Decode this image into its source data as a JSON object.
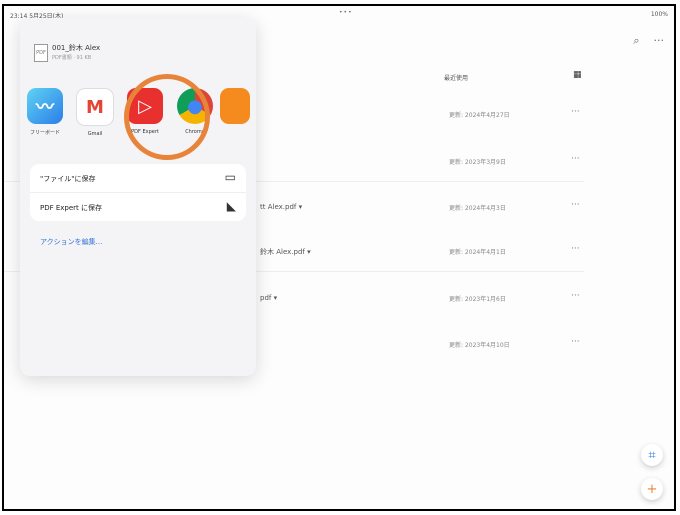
{
  "status": {
    "left": "23:14 5月25日(木)",
    "center": "•••",
    "right": "100%"
  },
  "toolbar": {
    "search": "⌕",
    "more": "···"
  },
  "list": {
    "header": "最近使用",
    "rows": [
      {
        "name": "",
        "date": "更新: 2024年4月27日"
      },
      {
        "name": "",
        "date": "更新: 2023年3月9日"
      },
      {
        "name": "tt Alex.pdf ▾",
        "date": "更新: 2024年4月3日"
      },
      {
        "name": "鈴木 Alex.pdf ▾",
        "date": "更新: 2024年4月1日"
      },
      {
        "name": "pdf ▾",
        "date": "更新: 2023年1月6日"
      },
      {
        "name": "",
        "date": "更新: 2023年4月10日"
      }
    ]
  },
  "share": {
    "doc_title": "001_鈴木 Alex",
    "doc_sub": "PDF書類 · 91 KB",
    "apps": [
      {
        "label": "フリーボード",
        "color": "#2b7de9",
        "glyph": "〰",
        "icon": "freeform-icon"
      },
      {
        "label": "Gmail",
        "color": "#ffffff",
        "glyph": "M",
        "icon": "gmail-icon"
      },
      {
        "label": "PDF Expert",
        "color": "#e8302f",
        "glyph": "▷",
        "icon": "pdf-expert-icon"
      },
      {
        "label": "Chrome",
        "color": "#f5c21b",
        "glyph": "●",
        "icon": "chrome-icon"
      }
    ],
    "actions": [
      {
        "label": "\"ファイル\"に保存",
        "icon": "folder-icon",
        "glyph": "▭"
      },
      {
        "label": "PDF Expert に保存",
        "icon": "pdf-expert-small-icon",
        "glyph": "◣"
      }
    ],
    "edit_actions": "アクションを編集..."
  },
  "fab": {
    "scan": "⌗",
    "add": "+"
  }
}
